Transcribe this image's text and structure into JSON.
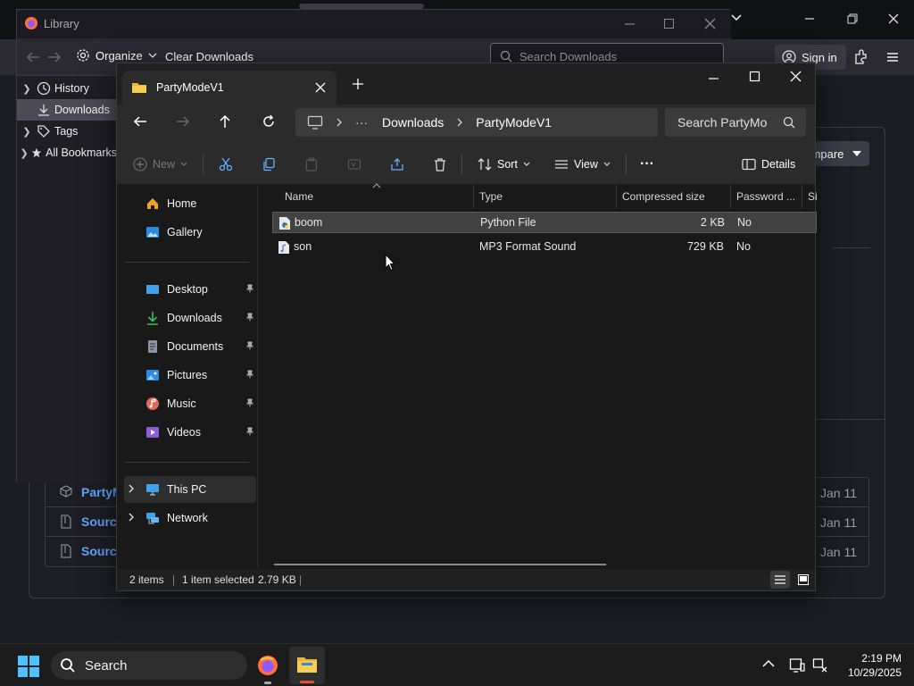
{
  "browser": {
    "signin_label": "Sign in",
    "compare_label": "mpare",
    "rows": [
      {
        "label": "PartyM",
        "date": "Jan 11",
        "icon": "package-icon"
      },
      {
        "label": "Source",
        "date": "Jan 11",
        "icon": "zip-icon"
      },
      {
        "label": "Source",
        "date": "Jan 11",
        "icon": "zip-icon"
      }
    ]
  },
  "library": {
    "title": "Library",
    "organize_label": "Organize",
    "clear_label": "Clear Downloads",
    "search_placeholder": "Search Downloads",
    "tree": [
      {
        "label": "History",
        "icon": "clock-icon"
      },
      {
        "label": "Downloads",
        "icon": "download-icon",
        "selected": true
      },
      {
        "label": "Tags",
        "icon": "tag-icon"
      },
      {
        "label": "All Bookmarks",
        "icon": "star-icon"
      }
    ]
  },
  "explorer": {
    "tab_title": "PartyModeV1",
    "breadcrumb": {
      "ellipsis": "···",
      "parent": "Downloads",
      "current": "PartyModeV1"
    },
    "search_placeholder": "Search PartyMo",
    "commands": {
      "new": "New",
      "sort": "Sort",
      "view": "View",
      "more": "···",
      "details": "Details"
    },
    "nav": {
      "quick": [
        {
          "label": "Home",
          "icon": "home-icon"
        },
        {
          "label": "Gallery",
          "icon": "gallery-icon"
        }
      ],
      "pinned": [
        {
          "label": "Desktop",
          "icon": "desktop-icon"
        },
        {
          "label": "Downloads",
          "icon": "download-icon"
        },
        {
          "label": "Documents",
          "icon": "documents-icon"
        },
        {
          "label": "Pictures",
          "icon": "pictures-icon"
        },
        {
          "label": "Music",
          "icon": "music-icon"
        },
        {
          "label": "Videos",
          "icon": "videos-icon"
        }
      ],
      "drives": [
        {
          "label": "This PC",
          "icon": "pc-icon"
        },
        {
          "label": "Network",
          "icon": "network-icon"
        }
      ]
    },
    "columns": [
      "Name",
      "Type",
      "Compressed size",
      "Password ...",
      "Si"
    ],
    "files": [
      {
        "name": "boom",
        "type": "Python File",
        "size": "2 KB",
        "password": "No",
        "selected": true,
        "icon": "python-file-icon"
      },
      {
        "name": "son",
        "type": "MP3 Format Sound",
        "size": "729 KB",
        "password": "No",
        "selected": false,
        "icon": "audio-file-icon"
      }
    ],
    "status": {
      "items": "2 items",
      "selected": "1 item selected",
      "size": "2.79 KB"
    }
  },
  "taskbar": {
    "search_label": "Search",
    "time": "2:19 PM",
    "date": "10/29/2025"
  }
}
